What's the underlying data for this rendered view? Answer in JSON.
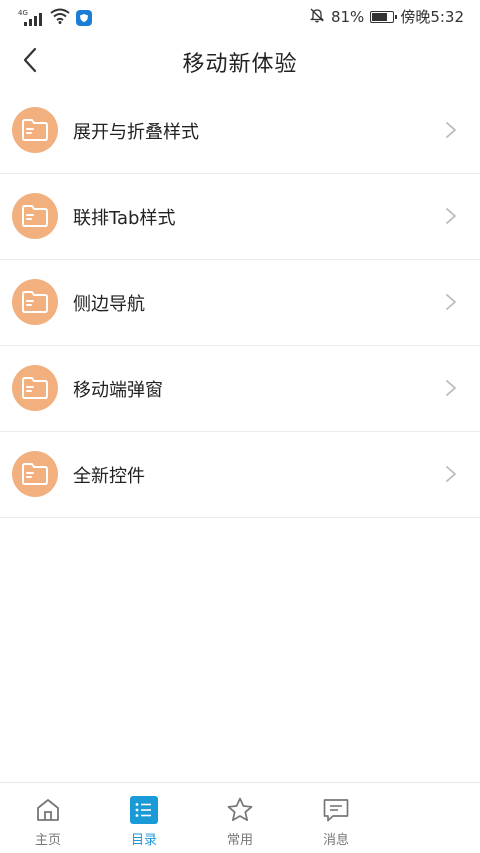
{
  "status_bar": {
    "network": "4G",
    "battery_percent": "81%",
    "battery_level": 0.81,
    "time": "傍晚5:32"
  },
  "header": {
    "title": "移动新体验"
  },
  "menu": {
    "items": [
      {
        "label": "展开与折叠样式",
        "icon": "folder-icon"
      },
      {
        "label": "联排Tab样式",
        "icon": "folder-icon"
      },
      {
        "label": "侧边导航",
        "icon": "folder-icon"
      },
      {
        "label": "移动端弹窗",
        "icon": "folder-icon"
      },
      {
        "label": "全新控件",
        "icon": "folder-icon"
      }
    ]
  },
  "bottom_nav": {
    "items": [
      {
        "label": "主页",
        "icon": "home-icon"
      },
      {
        "label": "目录",
        "icon": "list-icon",
        "active": true
      },
      {
        "label": "常用",
        "icon": "star-icon"
      },
      {
        "label": "消息",
        "icon": "message-icon"
      }
    ]
  },
  "colors": {
    "accent": "#1a9ad6",
    "folder_circle": "#f3b07f",
    "text": "#222222",
    "divider": "#ececec"
  }
}
